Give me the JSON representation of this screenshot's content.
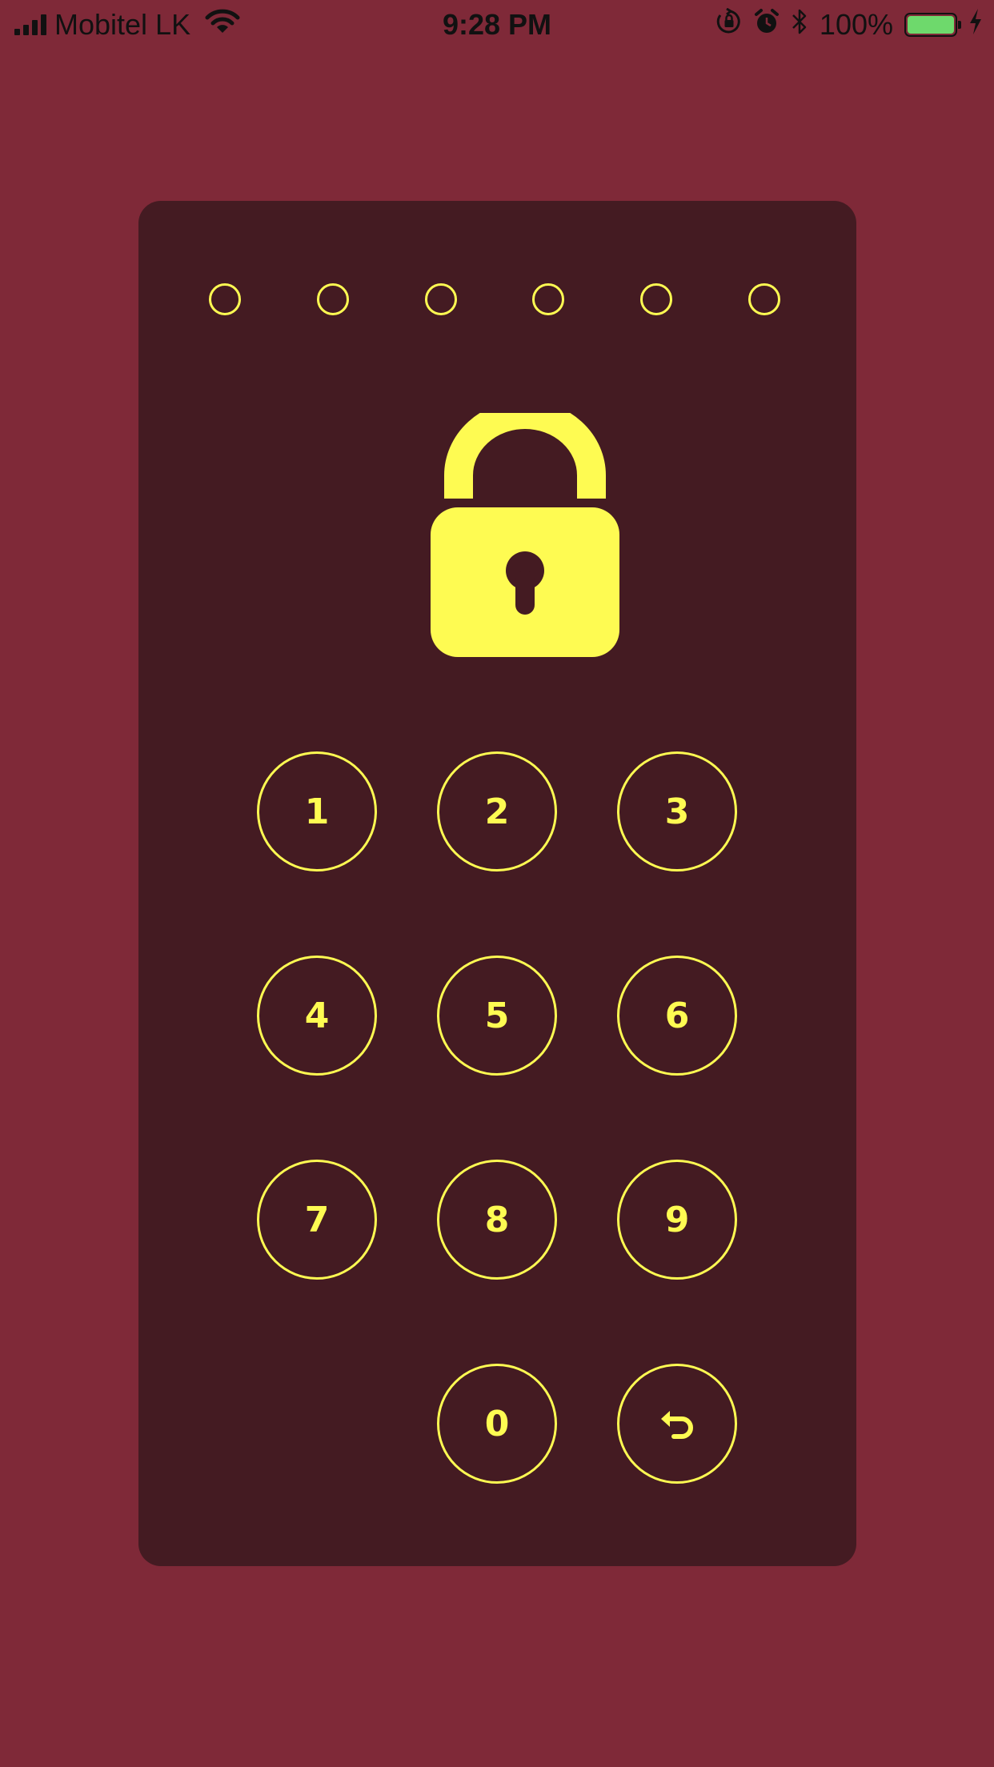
{
  "status_bar": {
    "carrier": "Mobitel LK",
    "time": "9:28 PM",
    "battery_percent_label": "100%",
    "battery_level": 1.0,
    "icons": [
      "signal-icon",
      "wifi-icon",
      "orientation-lock-icon",
      "alarm-icon",
      "bluetooth-icon",
      "battery-icon",
      "charging-icon"
    ]
  },
  "passcode": {
    "digits_total": 6,
    "digits_entered": 0,
    "lock_icon": "padlock-icon"
  },
  "keypad": {
    "keys": [
      "1",
      "2",
      "3",
      "4",
      "5",
      "6",
      "7",
      "8",
      "9",
      "0"
    ],
    "backspace_icon": "undo-arrow-icon"
  },
  "colors": {
    "background": "#7f2938",
    "panel": "#441b22",
    "accent": "#fefb52",
    "battery": "#6ed96c"
  }
}
